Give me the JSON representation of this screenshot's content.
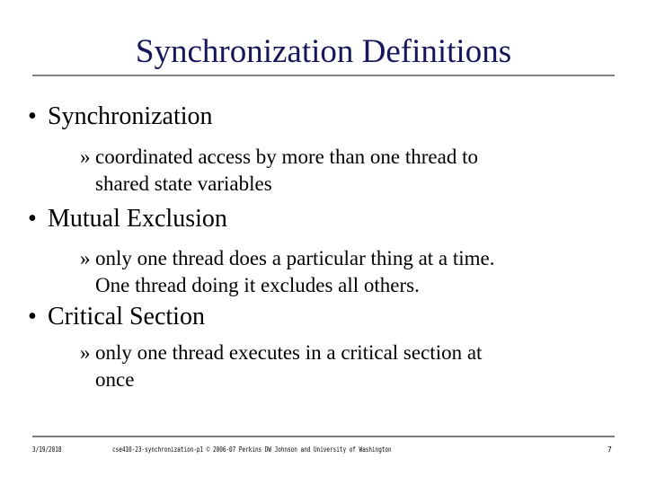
{
  "slide": {
    "title": "Synchronization Definitions",
    "bullets": [
      {
        "marker": "•",
        "text": "Synchronization",
        "sub": {
          "marker": "»",
          "lines": [
            "coordinated access by more than one thread to",
            "shared state variables"
          ]
        }
      },
      {
        "marker": "•",
        "text": "Mutual Exclusion",
        "sub": {
          "marker": "»",
          "lines": [
            "only one thread does a particular thing at a time.",
            "One thread doing it excludes all others."
          ]
        }
      },
      {
        "marker": "•",
        "text": "Critical Section",
        "sub": {
          "marker": "»",
          "lines": [
            "only one thread executes in a critical section at",
            "once"
          ]
        }
      }
    ]
  },
  "footer": {
    "date": "3/19/2018",
    "center": "cse410-23-synchronization-p1 © 2006-07 Perkins DW Johnson and University of Washington",
    "page": "7"
  },
  "colors": {
    "title": "#16165a",
    "rule": "#808080",
    "text": "#000000"
  }
}
